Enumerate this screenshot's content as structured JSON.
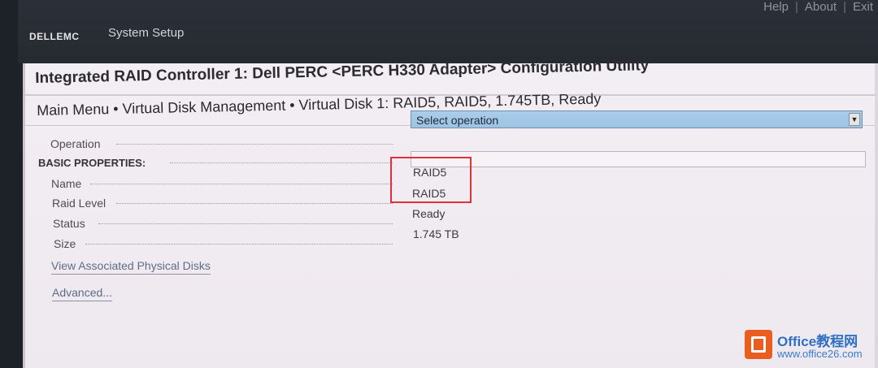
{
  "topbar": {
    "links": [
      "Help",
      "About",
      "Exit"
    ],
    "separator": "|",
    "logo": "DELLEMC",
    "section_title": "System Setup"
  },
  "header": {
    "title": "Integrated RAID Controller 1: Dell PERC <PERC H330 Adapter> Configuration Utility",
    "breadcrumb": "Main Menu • Virtual Disk Management • Virtual Disk 1: RAID5, RAID5, 1.745TB, Ready"
  },
  "form": {
    "operation": {
      "label": "Operation",
      "selected": "Select operation"
    },
    "basic_properties_heading": "BASIC PROPERTIES:",
    "properties": [
      {
        "label": "Name",
        "value": "RAID5"
      },
      {
        "label": "Raid Level",
        "value": "RAID5"
      },
      {
        "label": "Status",
        "value": "Ready"
      },
      {
        "label": "Size",
        "value": "1.745 TB"
      }
    ],
    "links": {
      "view_disks": "View Associated Physical Disks",
      "advanced": "Advanced..."
    }
  },
  "colors": {
    "select_bg": "#a9cdea",
    "highlight_border": "#e0303a",
    "panel_bg": "#f3eef3",
    "topbar_bg": "#2b3038"
  },
  "watermark": {
    "title": "Office教程网",
    "url": "www.office26.com"
  }
}
